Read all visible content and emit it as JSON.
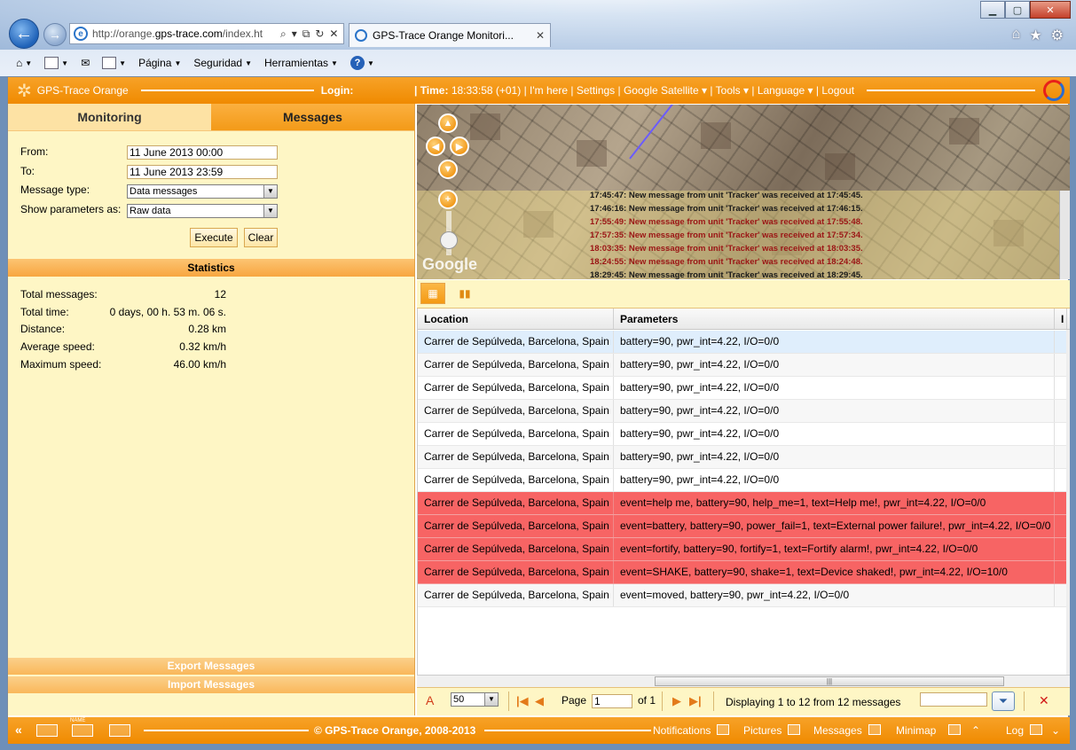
{
  "browser": {
    "url_prefix": "http://orange.",
    "url_domain": "gps-trace.com",
    "url_suffix": "/index.ht",
    "tab_title": "GPS-Trace Orange Monitori...",
    "menu": [
      "Página",
      "Seguridad",
      "Herramientas"
    ]
  },
  "topbar": {
    "brand": "GPS-Trace Orange",
    "login_label": "Login:",
    "time_label": "| Time:",
    "time_value": "18:33:58 (+01)",
    "links": [
      "I'm here",
      "Settings",
      "Google Satellite",
      "Tools",
      "Language",
      "Logout"
    ]
  },
  "left": {
    "tabs": [
      "Monitoring",
      "Messages"
    ],
    "from_label": "From:",
    "from_value": "11 June 2013 00:00",
    "to_label": "To:",
    "to_value": "11 June 2013 23:59",
    "message_type_label": "Message type:",
    "message_type_value": "Data messages",
    "show_params_label": "Show parameters as:",
    "show_params_value": "Raw data",
    "execute": "Execute",
    "clear": "Clear",
    "statistics_title": "Statistics",
    "stats": [
      {
        "label": "Total messages:",
        "value": "12"
      },
      {
        "label": "Total time:",
        "value": "0 days, 00 h. 53 m. 06 s."
      },
      {
        "label": "Distance:",
        "value": "0.28 km"
      },
      {
        "label": "Average speed:",
        "value": "0.32 km/h"
      },
      {
        "label": "Maximum speed:",
        "value": "46.00 km/h"
      }
    ],
    "export": "Export Messages",
    "import": "Import Messages"
  },
  "map": {
    "logo": "Google",
    "log": [
      {
        "time": "17:45:47",
        "text": "New message from unit 'Tracker' was received at 17:45:45.",
        "style": "a"
      },
      {
        "time": "17:46:16",
        "text": "New message from unit 'Tracker' was received at 17:46:15.",
        "style": "a"
      },
      {
        "time": "17:55:49",
        "text": "New message from unit 'Tracker' was received at 17:55:48.",
        "style": "b"
      },
      {
        "time": "17:57:35",
        "text": "New message from unit 'Tracker' was received at 17:57:34.",
        "style": "b"
      },
      {
        "time": "18:03:35",
        "text": "New message from unit 'Tracker' was received at 18:03:35.",
        "style": "b"
      },
      {
        "time": "18:24:55",
        "text": "New message from unit 'Tracker' was received at 18:24:48.",
        "style": "b"
      },
      {
        "time": "18:29:45",
        "text": "New message from unit 'Tracker' was received at 18:29:45.",
        "style": "a"
      }
    ]
  },
  "grid": {
    "columns": [
      "Location",
      "Parameters",
      "I"
    ],
    "rows": [
      {
        "location": "Carrer de Sepúlveda, Barcelona, Spain",
        "params": "battery=90, pwr_int=4.22, I/O=0/0",
        "kind": "sel"
      },
      {
        "location": "Carrer de Sepúlveda, Barcelona, Spain",
        "params": "battery=90, pwr_int=4.22, I/O=0/0",
        "kind": "alt"
      },
      {
        "location": "Carrer de Sepúlveda, Barcelona, Spain",
        "params": "battery=90, pwr_int=4.22, I/O=0/0",
        "kind": "norm"
      },
      {
        "location": "Carrer de Sepúlveda, Barcelona, Spain",
        "params": "battery=90, pwr_int=4.22, I/O=0/0",
        "kind": "alt"
      },
      {
        "location": "Carrer de Sepúlveda, Barcelona, Spain",
        "params": "battery=90, pwr_int=4.22, I/O=0/0",
        "kind": "norm"
      },
      {
        "location": "Carrer de Sepúlveda, Barcelona, Spain",
        "params": "battery=90, pwr_int=4.22, I/O=0/0",
        "kind": "alt"
      },
      {
        "location": "Carrer de Sepúlveda, Barcelona, Spain",
        "params": "battery=90, pwr_int=4.22, I/O=0/0",
        "kind": "norm"
      },
      {
        "location": "Carrer de Sepúlveda, Barcelona, Spain",
        "params": "event=help me, battery=90, help_me=1, text=Help me!, pwr_int=4.22, I/O=0/0",
        "kind": "red"
      },
      {
        "location": "Carrer de Sepúlveda, Barcelona, Spain",
        "params": "event=battery, battery=90, power_fail=1, text=External power failure!, pwr_int=4.22, I/O=0/0",
        "kind": "red"
      },
      {
        "location": "Carrer de Sepúlveda, Barcelona, Spain",
        "params": "event=fortify, battery=90, fortify=1, text=Fortify alarm!, pwr_int=4.22, I/O=0/0",
        "kind": "red"
      },
      {
        "location": "Carrer de Sepúlveda, Barcelona, Spain",
        "params": "event=SHAKE, battery=90, shake=1, text=Device shaked!, pwr_int=4.22, I/O=10/0",
        "kind": "red"
      },
      {
        "location": "Carrer de Sepúlveda, Barcelona, Spain",
        "params": "event=moved, battery=90, pwr_int=4.22, I/O=0/0",
        "kind": "alt"
      }
    ]
  },
  "pager": {
    "page_size": "50",
    "page_label": "Page",
    "page_value": "1",
    "of_label": "of 1",
    "display_text": "Displaying 1 to 12 from 12 messages"
  },
  "bottombar": {
    "copyright": "© GPS-Trace Orange, 2008-2013",
    "name_label": "NAME",
    "links": [
      "Notifications",
      "Pictures",
      "Messages",
      "Minimap",
      "Log"
    ]
  },
  "colors": {
    "accent": "#f08a00",
    "alarm_row": "#f76464",
    "panel": "#fef6c5"
  }
}
